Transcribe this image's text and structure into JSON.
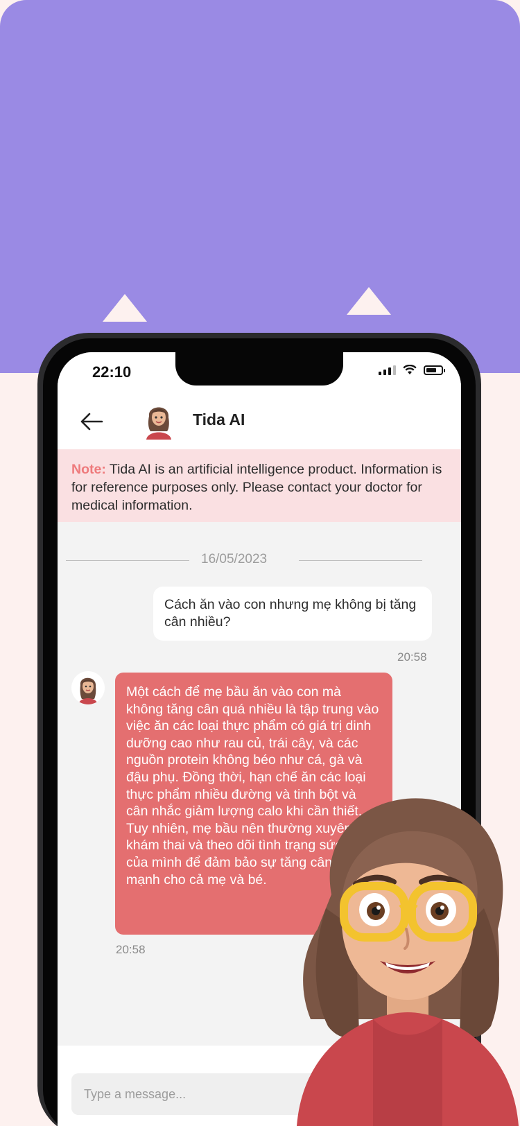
{
  "status_bar": {
    "time": "22:10"
  },
  "header": {
    "title": "Tida AI"
  },
  "note": {
    "label": "Note:",
    "text": " Tida AI is an artificial intelligence product. Information is for reference purposes only. Please contact your doctor for medical information."
  },
  "date_divider": "16/05/2023",
  "messages": [
    {
      "sender": "user",
      "text": "Cách ăn vào con nhưng mẹ không bị tăng cân nhiều?",
      "time": "20:58"
    },
    {
      "sender": "bot",
      "text": "Một cách để mẹ bầu ăn vào con mà không tăng cân quá nhiều là tập trung vào việc ăn các loại thực phẩm có giá trị dinh dưỡng cao như rau củ, trái cây, và các nguồn protein không béo như cá, gà và đậu phụ. Đồng thời, hạn chế ăn các loại thực phẩm nhiều đường và tinh bột và cân nhắc giảm lượng calo khi cần thiết. Tuy nhiên, mẹ bầu nên thường xuyên đi khám thai và theo dõi tình trạng sức khỏe của mình để đảm bảo sự tăng cân lành mạnh cho cả mẹ và bé.",
      "time": "20:58"
    }
  ],
  "composer": {
    "placeholder": "Type a message..."
  },
  "colors": {
    "purple": "#9a8ae4",
    "bot_bubble": "#e46f70",
    "note_bg": "#fae0e2",
    "note_label": "#ee7a7c"
  }
}
